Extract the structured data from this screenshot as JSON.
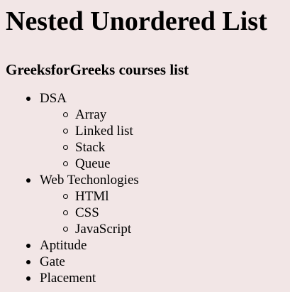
{
  "page": {
    "title": "Nested Unordered List",
    "subtitle": "GreeksforGreeks courses list"
  },
  "list": {
    "items": [
      {
        "label": "DSA",
        "children": [
          "Array",
          "Linked list",
          "Stack",
          "Queue"
        ]
      },
      {
        "label": "Web Techonlogies",
        "children": [
          "HTMl",
          "CSS",
          "JavaScript"
        ]
      },
      {
        "label": "Aptitude"
      },
      {
        "label": "Gate"
      },
      {
        "label": "Placement"
      }
    ]
  }
}
